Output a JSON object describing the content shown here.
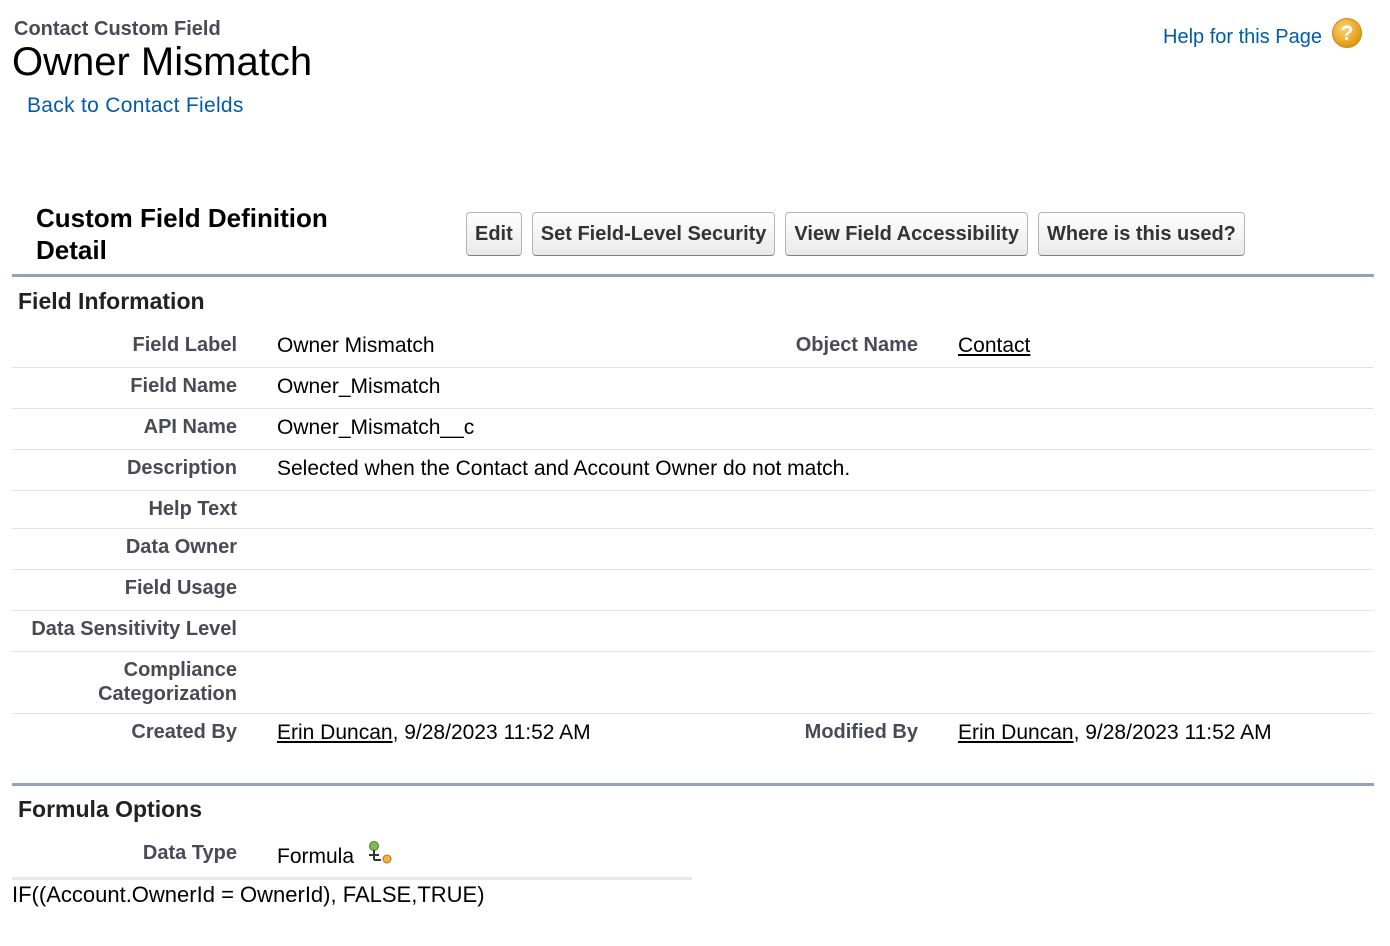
{
  "header": {
    "object_type": "Contact Custom Field",
    "title": "Owner Mismatch",
    "back_link": "Back to Contact Fields",
    "help_link": "Help for this Page",
    "help_icon": "question-icon"
  },
  "detail": {
    "title": "Custom Field Definition Detail",
    "buttons": {
      "edit": "Edit",
      "set_fls": "Set Field-Level Security",
      "view_access": "View Field Accessibility",
      "where_used": "Where is this used?"
    }
  },
  "field_info": {
    "heading": "Field Information",
    "field_label": {
      "label": "Field Label",
      "value": "Owner Mismatch"
    },
    "object_name": {
      "label": "Object Name",
      "value": "Contact"
    },
    "field_name": {
      "label": "Field Name",
      "value": "Owner_Mismatch"
    },
    "api_name": {
      "label": "API Name",
      "value": "Owner_Mismatch__c"
    },
    "description": {
      "label": "Description",
      "value": "Selected when the Contact and Account Owner do not match."
    },
    "help_text": {
      "label": "Help Text",
      "value": ""
    },
    "data_owner": {
      "label": "Data Owner",
      "value": ""
    },
    "field_usage": {
      "label": "Field Usage",
      "value": ""
    },
    "sensitivity": {
      "label": "Data Sensitivity Level",
      "value": ""
    },
    "compliance": {
      "label_line1": "Compliance",
      "label_line2": "Categorization",
      "value": ""
    },
    "created_by": {
      "label": "Created By",
      "user": "Erin Duncan",
      "date": ", 9/28/2023 11:52 AM"
    },
    "modified_by": {
      "label": "Modified By",
      "user": "Erin Duncan",
      "date": ", 9/28/2023 11:52 AM"
    }
  },
  "formula_options": {
    "heading": "Formula Options",
    "data_type": {
      "label": "Data Type",
      "value": "Formula",
      "icon": "formula-icon"
    },
    "formula": "IF((Account.OwnerId = OwnerId), FALSE,TRUE)"
  },
  "colors": {
    "link": "#015ba7",
    "divider": "#94a1b8",
    "label": "#4a4a56"
  }
}
